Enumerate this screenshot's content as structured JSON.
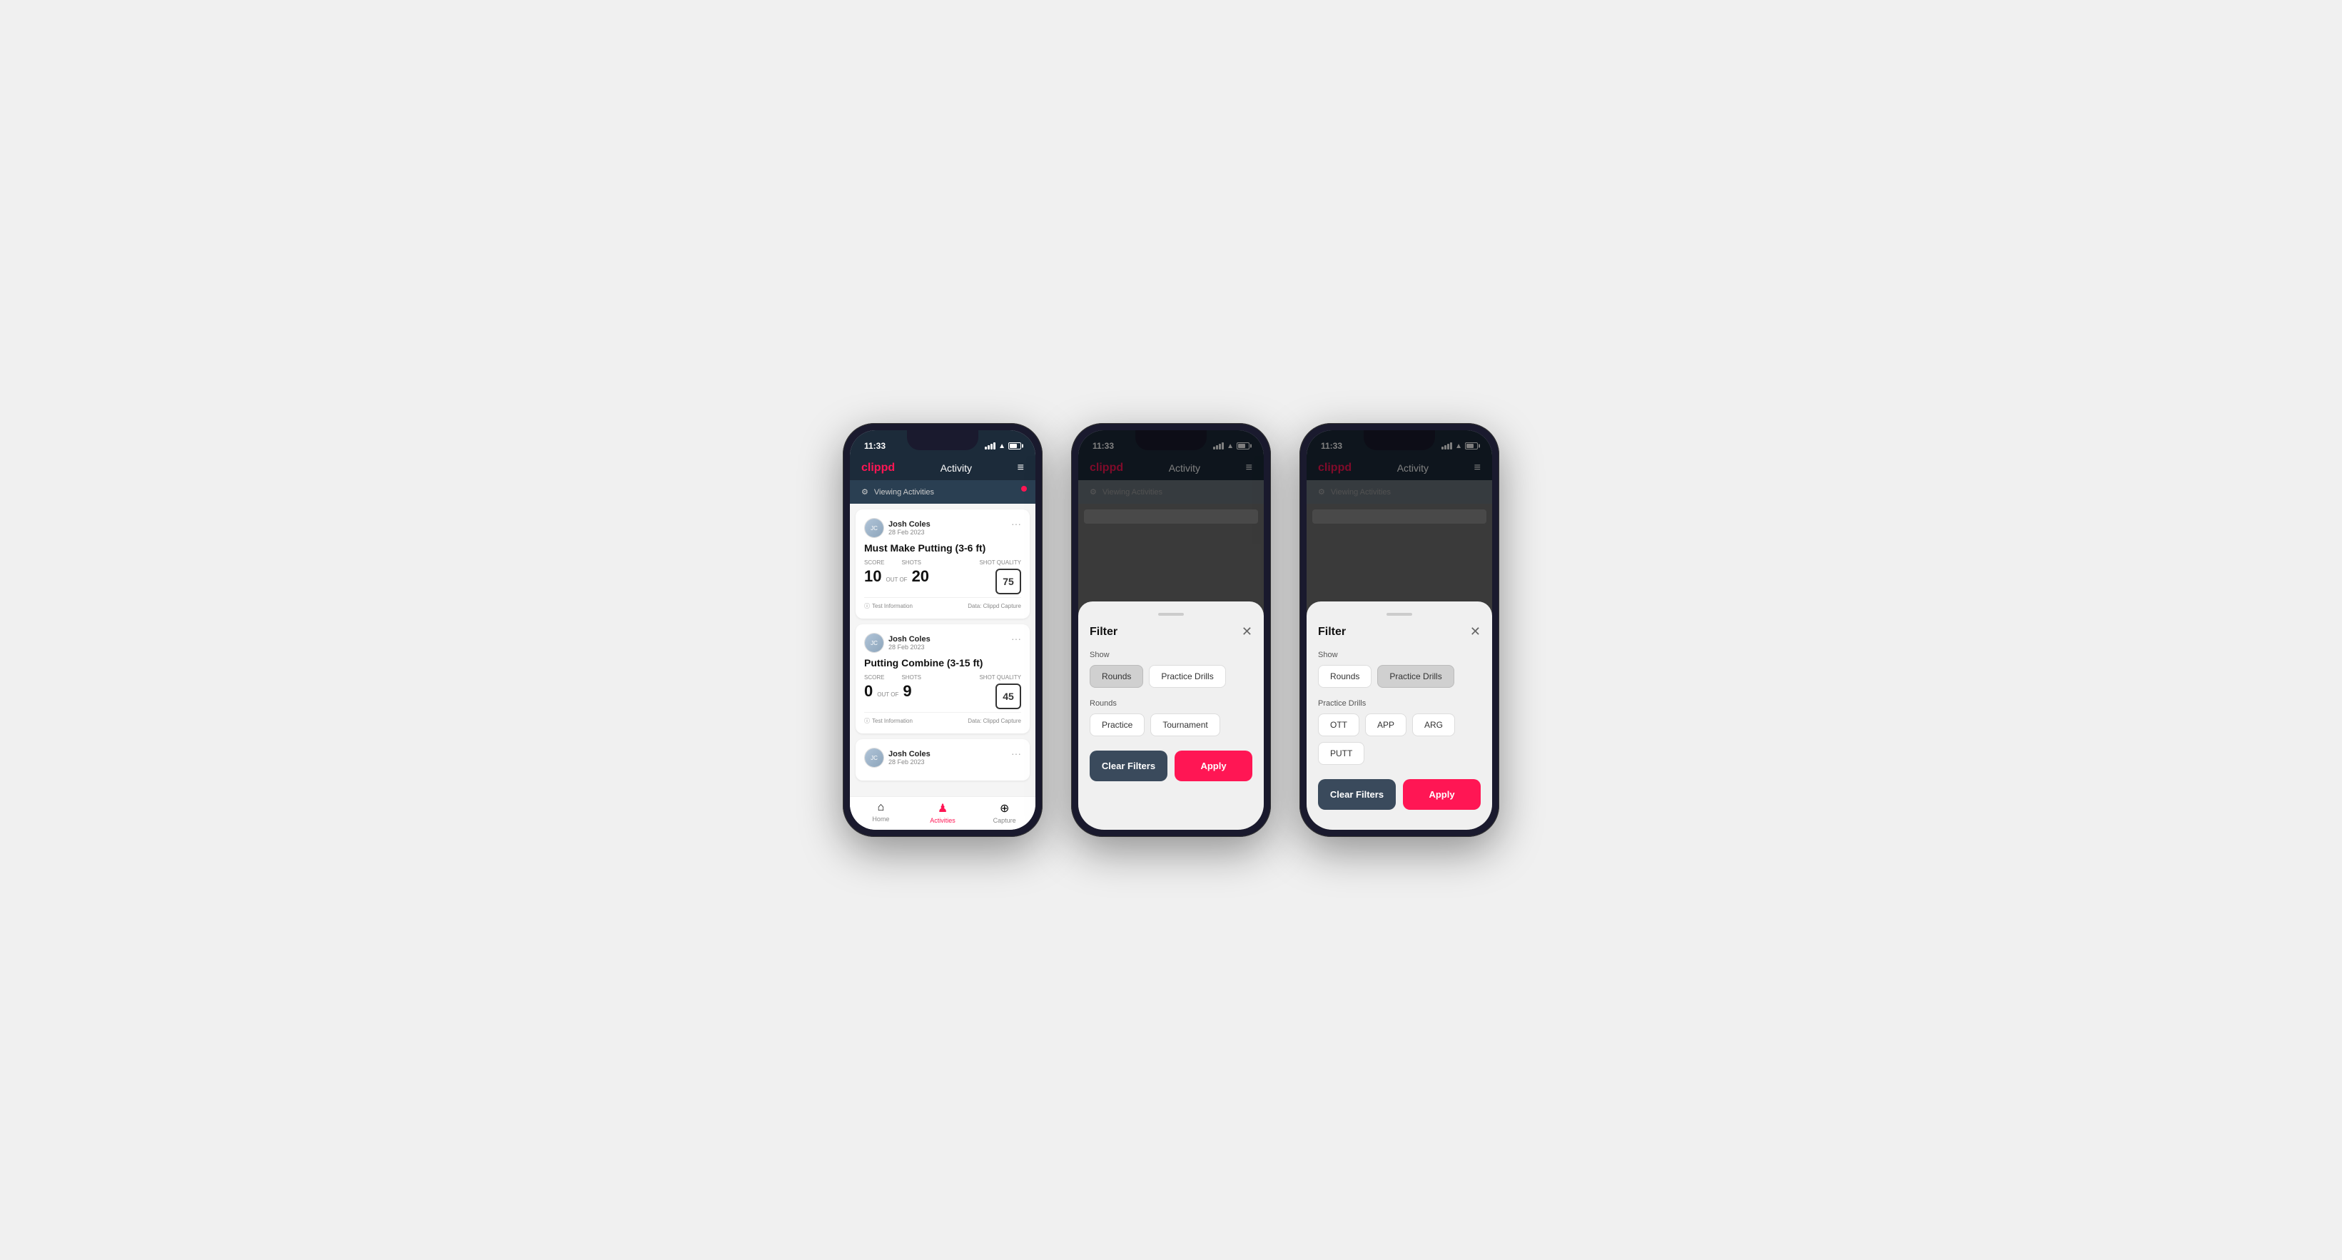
{
  "phones": [
    {
      "id": "phone1",
      "statusBar": {
        "time": "11:33",
        "battery": "31"
      },
      "navBar": {
        "logo": "clippd",
        "title": "Activity",
        "menuIcon": "≡"
      },
      "viewingActivities": {
        "label": "Viewing Activities"
      },
      "activities": [
        {
          "id": "activity1",
          "userName": "Josh Coles",
          "userDate": "28 Feb 2023",
          "title": "Must Make Putting (3-6 ft)",
          "score": {
            "scoreLabel": "Score",
            "scoreValue": "10",
            "outOf": "OUT OF",
            "shotsLabel": "Shots",
            "shotsValue": "20",
            "shotQualityLabel": "Shot Quality",
            "shotQualityValue": "75"
          },
          "footer": {
            "testInfo": "Test Information",
            "dataSource": "Data: Clippd Capture"
          }
        },
        {
          "id": "activity2",
          "userName": "Josh Coles",
          "userDate": "28 Feb 2023",
          "title": "Putting Combine (3-15 ft)",
          "score": {
            "scoreLabel": "Score",
            "scoreValue": "0",
            "outOf": "OUT OF",
            "shotsLabel": "Shots",
            "shotsValue": "9",
            "shotQualityLabel": "Shot Quality",
            "shotQualityValue": "45"
          },
          "footer": {
            "testInfo": "Test Information",
            "dataSource": "Data: Clippd Capture"
          }
        },
        {
          "id": "activity3",
          "userName": "Josh Coles",
          "userDate": "28 Feb 2023",
          "title": "",
          "score": null,
          "footer": null
        }
      ],
      "bottomNav": [
        {
          "id": "home",
          "icon": "🏠",
          "label": "Home",
          "active": false
        },
        {
          "id": "activities",
          "icon": "👤",
          "label": "Activities",
          "active": true
        },
        {
          "id": "capture",
          "icon": "⊕",
          "label": "Capture",
          "active": false
        }
      ]
    },
    {
      "id": "phone2",
      "statusBar": {
        "time": "11:33",
        "battery": "31"
      },
      "navBar": {
        "logo": "clippd",
        "title": "Activity",
        "menuIcon": "≡"
      },
      "viewingActivities": {
        "label": "Viewing Activities"
      },
      "filter": {
        "title": "Filter",
        "showLabel": "Show",
        "showOptions": [
          {
            "id": "rounds",
            "label": "Rounds",
            "active": true
          },
          {
            "id": "practice-drills",
            "label": "Practice Drills",
            "active": false
          }
        ],
        "roundsLabel": "Rounds",
        "roundsOptions": [
          {
            "id": "practice",
            "label": "Practice",
            "active": false
          },
          {
            "id": "tournament",
            "label": "Tournament",
            "active": false
          }
        ],
        "clearFiltersLabel": "Clear Filters",
        "applyLabel": "Apply"
      }
    },
    {
      "id": "phone3",
      "statusBar": {
        "time": "11:33",
        "battery": "31"
      },
      "navBar": {
        "logo": "clippd",
        "title": "Activity",
        "menuIcon": "≡"
      },
      "viewingActivities": {
        "label": "Viewing Activities"
      },
      "filter": {
        "title": "Filter",
        "showLabel": "Show",
        "showOptions": [
          {
            "id": "rounds",
            "label": "Rounds",
            "active": false
          },
          {
            "id": "practice-drills",
            "label": "Practice Drills",
            "active": true
          }
        ],
        "practiceDrillsLabel": "Practice Drills",
        "practiceDrillsOptions": [
          {
            "id": "ott",
            "label": "OTT",
            "active": false
          },
          {
            "id": "app",
            "label": "APP",
            "active": false
          },
          {
            "id": "arg",
            "label": "ARG",
            "active": false
          },
          {
            "id": "putt",
            "label": "PUTT",
            "active": false
          }
        ],
        "clearFiltersLabel": "Clear Filters",
        "applyLabel": "Apply"
      }
    }
  ]
}
